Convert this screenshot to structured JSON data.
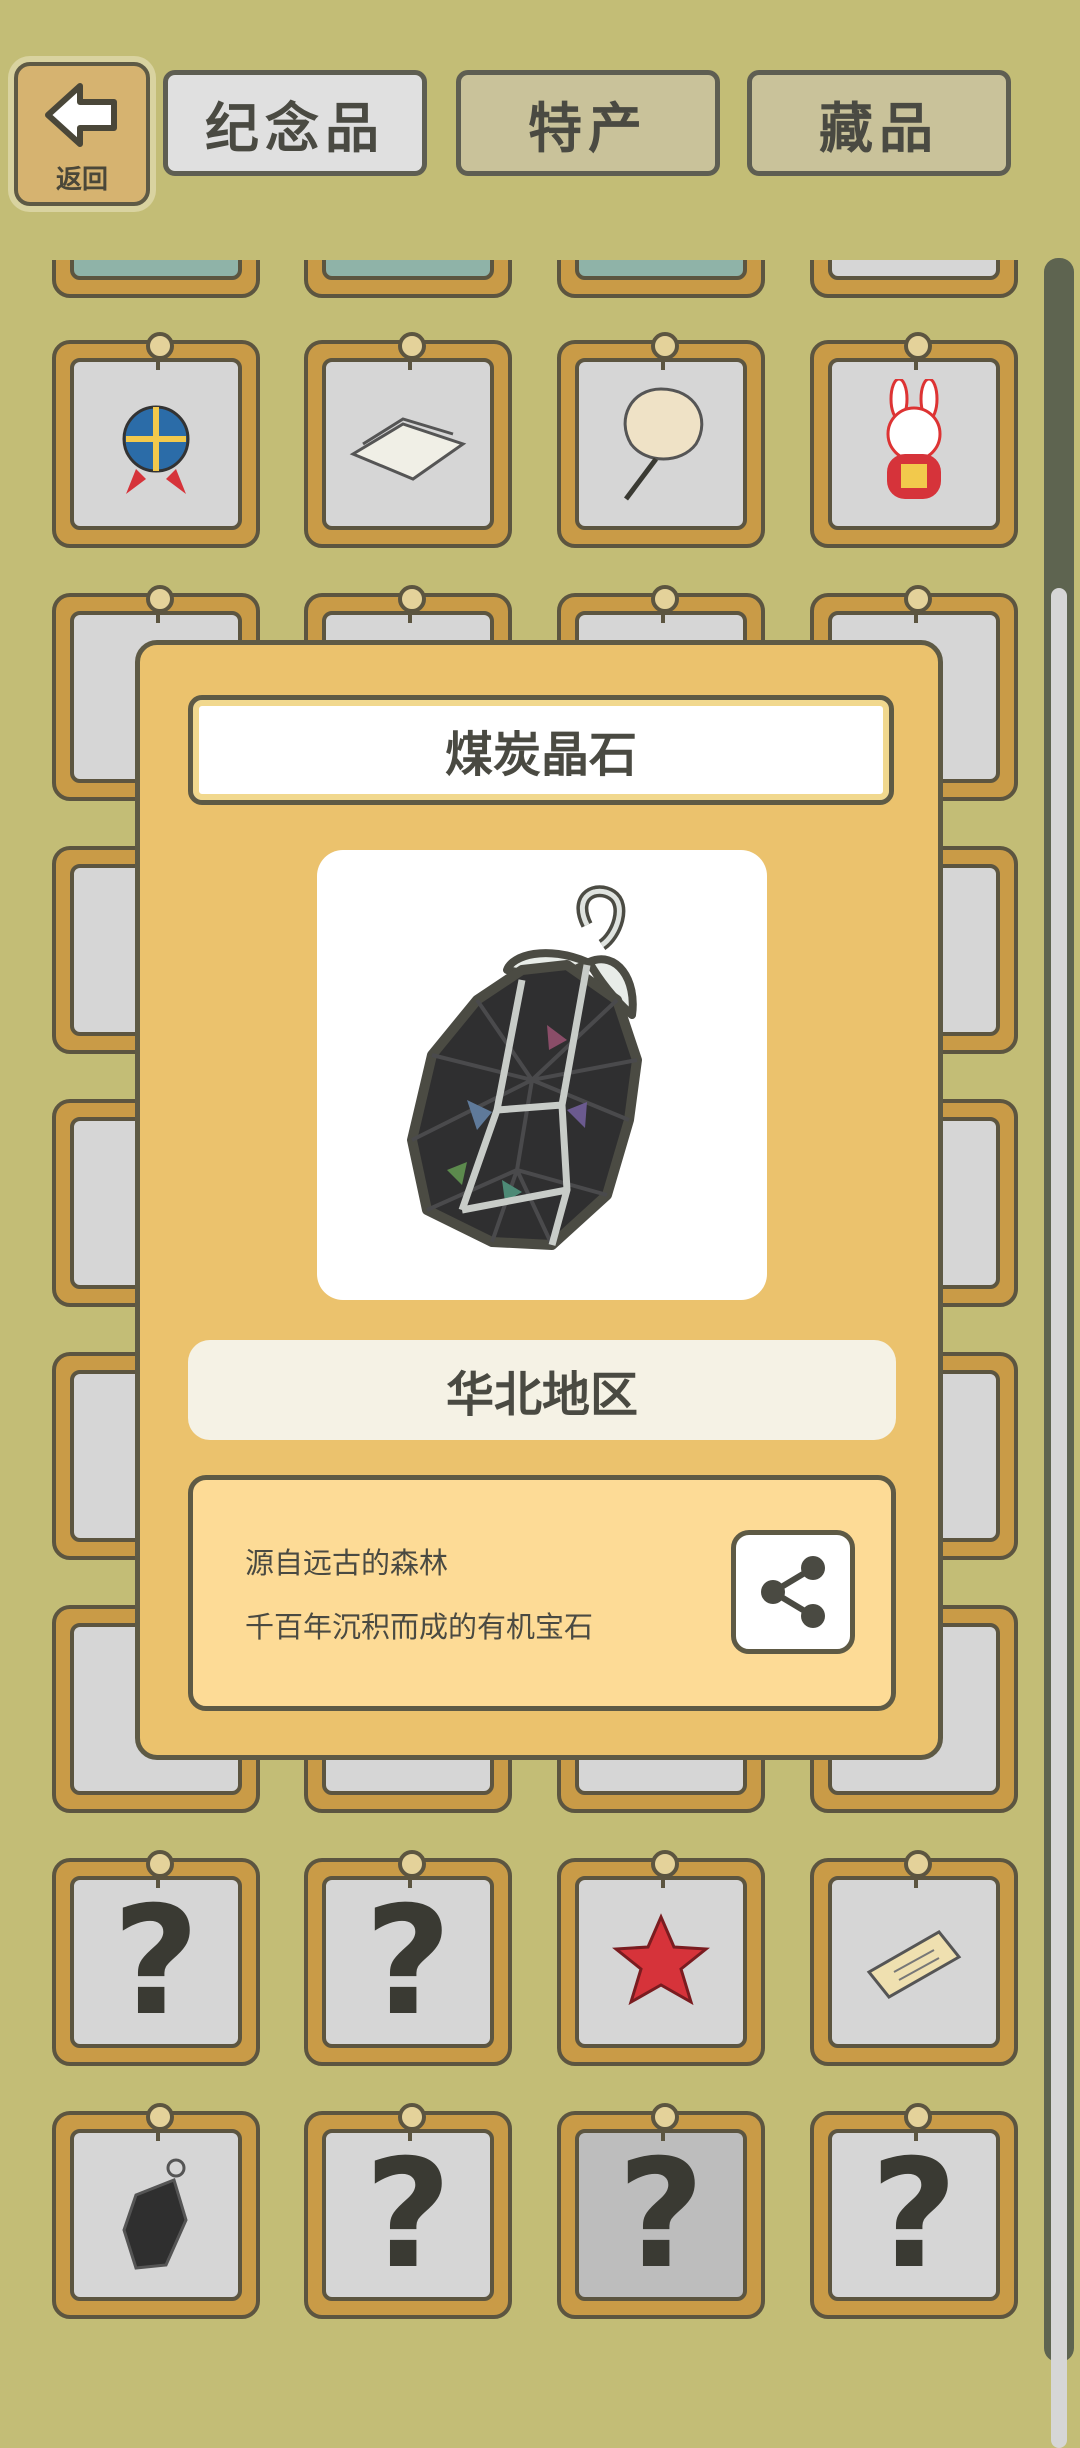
{
  "header": {
    "back_label": "返回",
    "tabs": [
      {
        "label": "纪念品",
        "active": true
      },
      {
        "label": "特产",
        "active": false
      },
      {
        "label": "藏品",
        "active": false
      }
    ]
  },
  "grid": {
    "rows": [
      [
        "temari-ball",
        "folded-cloth",
        "hand-fan",
        "rabbit-figure"
      ],
      [
        "hidden",
        "hidden",
        "hidden",
        "hidden"
      ],
      [
        "hidden",
        "hidden",
        "hidden",
        "hidden"
      ],
      [
        "hidden",
        "hidden",
        "hidden",
        "hidden"
      ],
      [
        "hidden",
        "hidden",
        "hidden",
        "hidden"
      ],
      [
        "hidden",
        "hidden",
        "hidden",
        "hidden"
      ],
      [
        "?",
        "?",
        "red-star-cloth",
        "book"
      ],
      [
        "coal-crystal-pendant",
        "?",
        "?",
        "?"
      ]
    ]
  },
  "modal": {
    "title": "煤炭晶石",
    "region": "华北地区",
    "description": [
      "源自远古的森林",
      "千百年沉积而成的有机宝石"
    ],
    "item_icon": "coal-crystal-pendant",
    "share_icon": "share-icon"
  },
  "colors": {
    "background": "#c3bd76",
    "modal_bg": "#ebc26d",
    "frame": "#c99b47",
    "outline": "#5e5a45"
  }
}
